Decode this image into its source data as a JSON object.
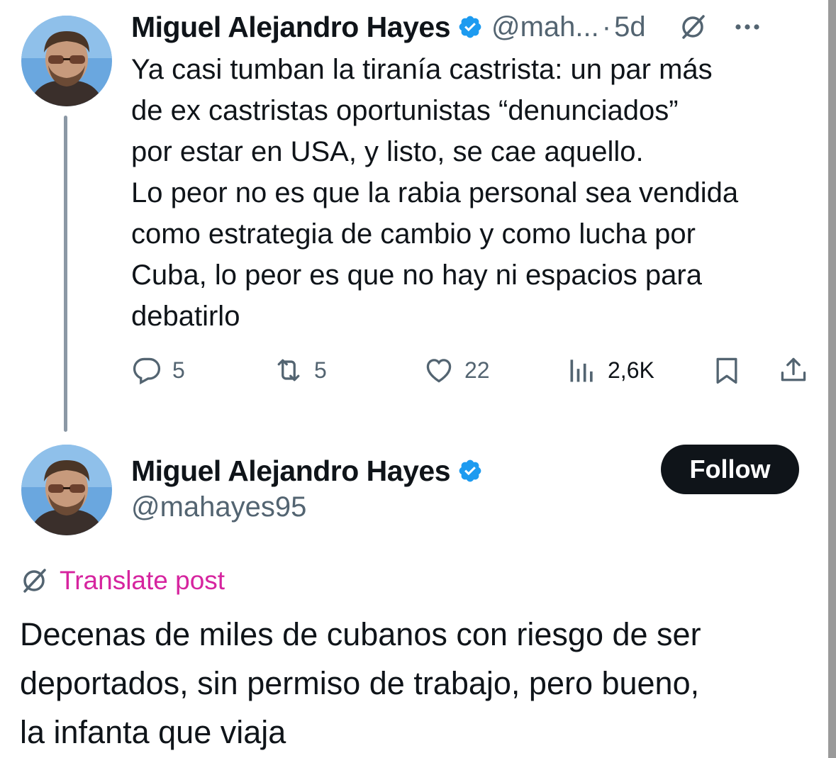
{
  "tweet1": {
    "author_name": "Miguel Alejandro Hayes",
    "handle_truncated": "@mah...",
    "separator": "·",
    "time": "5d",
    "text_lines": [
      "Ya casi tumban la tiranía castrista: un par más",
      "de ex castristas oportunistas “denunciados”",
      "por estar en USA, y listo, se cae aquello.",
      "Lo peor no es que la rabia personal sea vendida",
      "como estrategia de cambio y como lucha por",
      "Cuba, lo peor es que no hay ni espacios para",
      "debatirlo"
    ],
    "actions": {
      "replies": "5",
      "reposts": "5",
      "likes": "22",
      "views": "2,6K"
    }
  },
  "tweet2": {
    "author_name": "Miguel Alejandro Hayes",
    "handle": "@mahayes95",
    "follow_label": "Follow",
    "translate_label": "Translate post",
    "text_lines": [
      "Decenas de miles de cubanos con riesgo de ser",
      "deportados, sin permiso de trabajo, pero bueno,",
      "la infanta que viaja"
    ]
  },
  "colors": {
    "text_primary": "#0f1419",
    "text_secondary": "#536471",
    "verified_blue": "#1d9bf0",
    "translate_pink": "#d6249f",
    "follow_bg": "#0f1419"
  },
  "icons": [
    "verified-badge-icon",
    "grok-icon",
    "more-icon",
    "reply-icon",
    "repost-icon",
    "like-icon",
    "views-icon",
    "bookmark-icon",
    "share-icon",
    "translate-icon"
  ]
}
